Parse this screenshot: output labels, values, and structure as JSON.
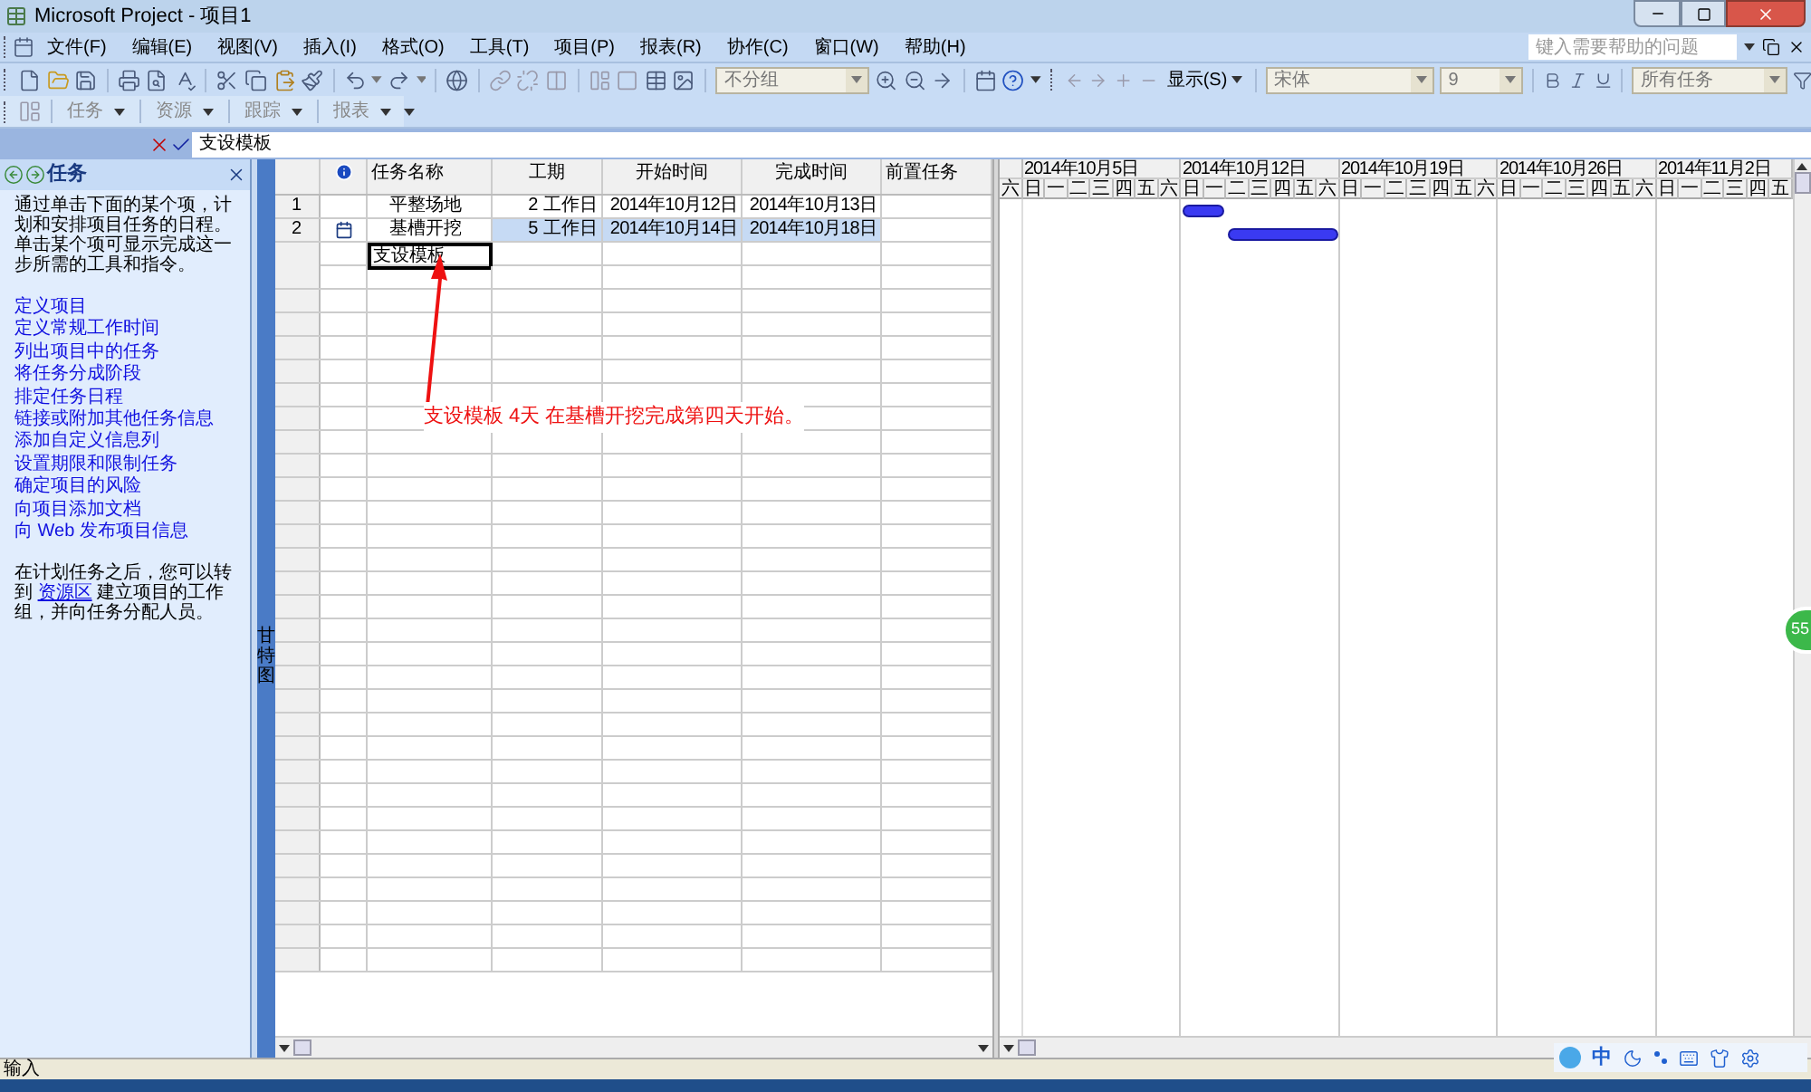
{
  "window": {
    "title": "Microsoft Project - 项目1"
  },
  "menu": [
    {
      "label": "文件(F)"
    },
    {
      "label": "编辑(E)"
    },
    {
      "label": "视图(V)"
    },
    {
      "label": "插入(I)"
    },
    {
      "label": "格式(O)"
    },
    {
      "label": "工具(T)"
    },
    {
      "label": "项目(P)"
    },
    {
      "label": "报表(R)"
    },
    {
      "label": "协作(C)"
    },
    {
      "label": "窗口(W)"
    },
    {
      "label": "帮助(H)"
    }
  ],
  "help_box": {
    "placeholder": "键入需要帮助的问题"
  },
  "toolbar": {
    "group_combo": "不分组",
    "show_button": "显示(S)",
    "font_combo": "宋体",
    "size_combo": "9",
    "filter_combo": "所有任务"
  },
  "toolbar2": [
    {
      "label": "任务"
    },
    {
      "label": "资源"
    },
    {
      "label": "跟踪"
    },
    {
      "label": "报表"
    }
  ],
  "entry_bar": {
    "value": "支设模板"
  },
  "task_pane": {
    "title": "任务",
    "intro": "通过单击下面的某个项，计划和安排项目任务的日程。单击某个项可显示完成这一步所需的工具和指令。",
    "links": [
      "定义项目",
      "定义常规工作时间",
      "列出项目中的任务",
      "将任务分成阶段",
      "排定任务日程",
      "链接或附加其他任务信息",
      "添加自定义信息列",
      "设置期限和限制任务",
      "确定项目的风险",
      "向项目添加文档",
      "向 Web 发布项目信息"
    ],
    "footer_before": "在计划任务之后，您可以转到",
    "footer_link": "资源区",
    "footer_after": "建立项目的工作组，并向任务分配人员。"
  },
  "view_bar": {
    "label": "甘特图"
  },
  "table": {
    "columns": [
      "任务名称",
      "工期",
      "开始时间",
      "完成时间",
      "前置任务"
    ],
    "rows": [
      {
        "id": "1",
        "name": "平整场地",
        "duration": "2 工作日",
        "start": "2014年10月12日",
        "finish": "2014年10月13日",
        "indicator": false,
        "selected": false
      },
      {
        "id": "2",
        "name": "基槽开挖",
        "duration": "5 工作日",
        "start": "2014年10月14日",
        "finish": "2014年10月18日",
        "indicator": true,
        "selected": true
      }
    ],
    "editing_cell": "支设模板"
  },
  "timeline": {
    "weeks": [
      "2014年10月5日",
      "2014年10月12日",
      "2014年10月19日",
      "2014年10月26日",
      "2014年11月2日"
    ],
    "days": [
      "六",
      "日",
      "一",
      "二",
      "三",
      "四",
      "五",
      "六",
      "日",
      "一",
      "二",
      "三",
      "四",
      "五",
      "六",
      "日",
      "一",
      "二",
      "三",
      "四",
      "五",
      "六",
      "日",
      "一",
      "二",
      "三",
      "四",
      "五",
      "六",
      "日",
      "一",
      "二",
      "三",
      "四",
      "五"
    ]
  },
  "annotation": {
    "text": "支设模板 4天 在基槽开挖完成第四天开始。"
  },
  "status_bar": {
    "mode": "输入"
  },
  "ime_bar": {
    "label": "中"
  },
  "floating_badge": "55"
}
